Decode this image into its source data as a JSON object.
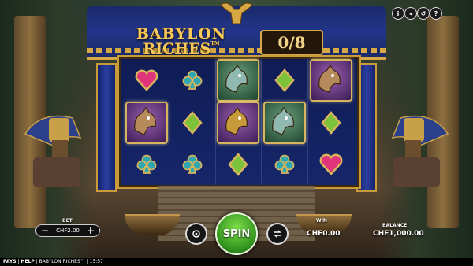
{
  "game": {
    "logo_line1": "BABYLON",
    "logo_line2": "RICHES",
    "logo_tm": "TM",
    "counter": "0/8"
  },
  "top_icons": [
    {
      "name": "info-icon",
      "glyph": "i"
    },
    {
      "name": "sound-icon",
      "glyph": "◂"
    },
    {
      "name": "history-icon",
      "glyph": "↺"
    },
    {
      "name": "help-icon",
      "glyph": "?"
    }
  ],
  "reels": [
    [
      "heart",
      "hero-purple",
      "club"
    ],
    [
      "club",
      "diamond",
      "club"
    ],
    [
      "hero-green",
      "hero-gold",
      "diamond"
    ],
    [
      "diamond",
      "hero-green",
      "club"
    ],
    [
      "hero-purple",
      "diamond",
      "heart"
    ]
  ],
  "symbol_colors": {
    "heart": "#e0357a",
    "club": "#2fa6b0",
    "diamond": "#7cc23a",
    "gold_rim": "#d7b45e"
  },
  "controls": {
    "bet_label": "BET",
    "bet_value": "CHF2.00",
    "minus": "−",
    "plus": "+",
    "spin_label": "SPIN",
    "win_label": "WIN",
    "win_value": "CHF0.00",
    "balance_label": "BALANCE",
    "balance_value": "CHF1,000.00"
  },
  "footer": {
    "pays": "PAYS",
    "help": "HELP",
    "title": "BABYLON RICHES™",
    "time": "15:57"
  }
}
